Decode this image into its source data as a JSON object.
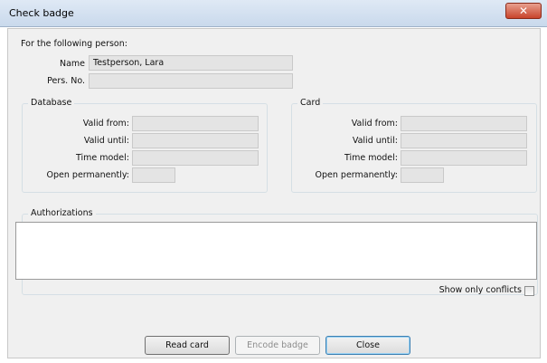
{
  "window": {
    "title": "Check badge",
    "close_symbol": "✕"
  },
  "person": {
    "heading": "For the following person:",
    "name_label": "Name",
    "name_value": "Testperson, Lara",
    "persno_label": "Pers. No.",
    "persno_value": ""
  },
  "database": {
    "title": "Database",
    "valid_from_label": "Valid from:",
    "valid_until_label": "Valid until:",
    "time_model_label": "Time model:",
    "open_perm_label": "Open permanently:",
    "valid_from": "",
    "valid_until": "",
    "time_model": "",
    "open_perm": ""
  },
  "card": {
    "title": "Card",
    "valid_from_label": "Valid from:",
    "valid_until_label": "Valid until:",
    "time_model_label": "Time model:",
    "open_perm_label": "Open permanently:",
    "valid_from": "",
    "valid_until": "",
    "time_model": "",
    "open_perm": ""
  },
  "authorizations": {
    "title": "Authorizations",
    "show_conflicts_label": "Show only conflicts",
    "show_conflicts_checked": false
  },
  "buttons": {
    "read_card": "Read card",
    "encode_badge": "Encode badge",
    "close": "Close"
  }
}
